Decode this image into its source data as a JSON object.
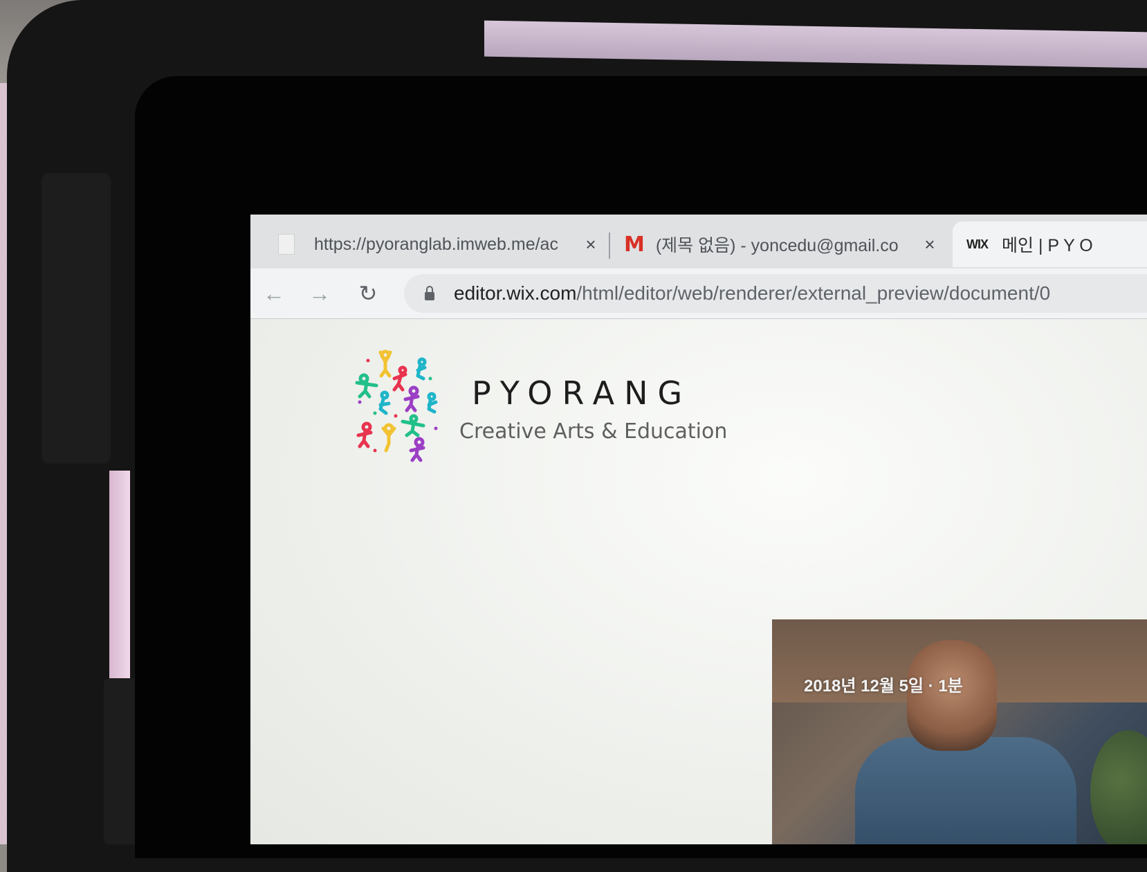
{
  "browser": {
    "tabs": [
      {
        "title": "https://pyoranglab.imweb.me/ac",
        "close": "×"
      },
      {
        "favicon": "M",
        "title": "(제목 없음) - yoncedu@gmail.co",
        "close": "×"
      },
      {
        "favicon": "WIX",
        "title": "메인 | P Y O"
      }
    ],
    "nav": {
      "back": "←",
      "forward": "→",
      "reload": "↻"
    },
    "address": {
      "host": "editor.wix.com",
      "path": "/html/editor/web/renderer/external_preview/document/0"
    }
  },
  "site": {
    "brand": "PYORANG",
    "tagline": "Creative Arts & Education",
    "post": {
      "meta": "2018년 12월 5일  ·  1분"
    }
  },
  "colors": {
    "gmail_red": "#d93025",
    "logo": [
      "#f2c232",
      "#1fb5c9",
      "#e8344f",
      "#9b3fc4",
      "#22c08a"
    ]
  }
}
